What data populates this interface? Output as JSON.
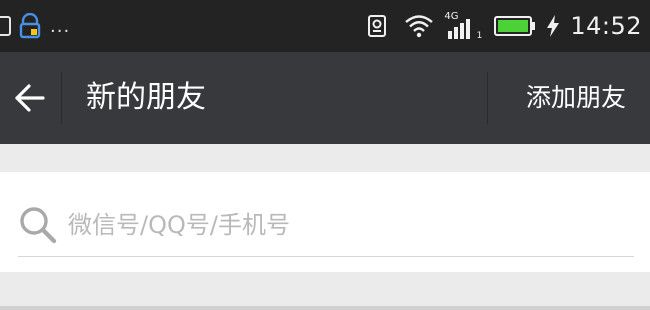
{
  "status_bar": {
    "time": "14:52",
    "network": "4G",
    "sim_slot": "1",
    "overflow": "...",
    "battery_color": "#4cd137",
    "icons": [
      "image-icon",
      "lock-notification-icon",
      "vibrate-icon",
      "wifi-icon",
      "signal-icon",
      "battery-icon",
      "charging-icon"
    ]
  },
  "header": {
    "title": "新的朋友",
    "action_label": "添加朋友",
    "back_icon": "arrow-left-icon",
    "background": "#38393d"
  },
  "search": {
    "placeholder": "微信号/QQ号/手机号",
    "value": "",
    "icon": "search-icon"
  }
}
